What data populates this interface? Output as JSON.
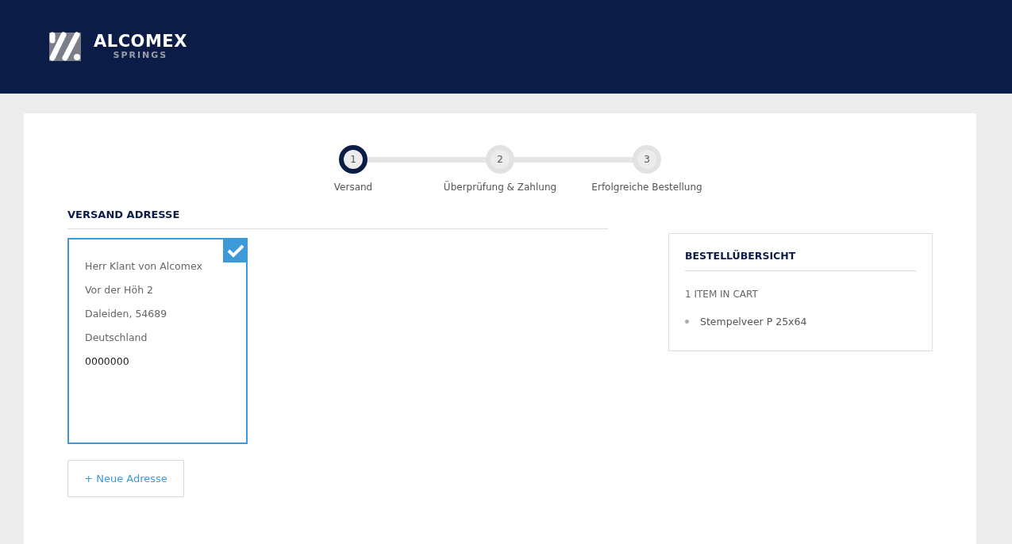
{
  "header": {
    "logo": {
      "name": "ALCOMEX",
      "tagline": "SPRINGS"
    }
  },
  "steps": [
    {
      "number": "1",
      "label": "Versand",
      "selected": true
    },
    {
      "number": "2",
      "label": "Überprüfung & Zahlung",
      "selected": false
    },
    {
      "number": "3",
      "label": "Erfolgreiche Bestellung",
      "selected": false
    }
  ],
  "shipping": {
    "title": "VERSAND ADRESSE",
    "addresses": [
      {
        "selected": true,
        "lines": [
          "Herr Klant von Alcomex",
          "Vor der Höh 2",
          "Daleiden, 54689",
          "Deutschland"
        ],
        "phone": "0000000"
      }
    ],
    "add_button": "+ Neue Adresse"
  },
  "summary": {
    "title": "BESTELLÜBERSICHT",
    "count": "1 ITEM IN CART",
    "items": [
      "Stempelveer P 25x64"
    ]
  }
}
